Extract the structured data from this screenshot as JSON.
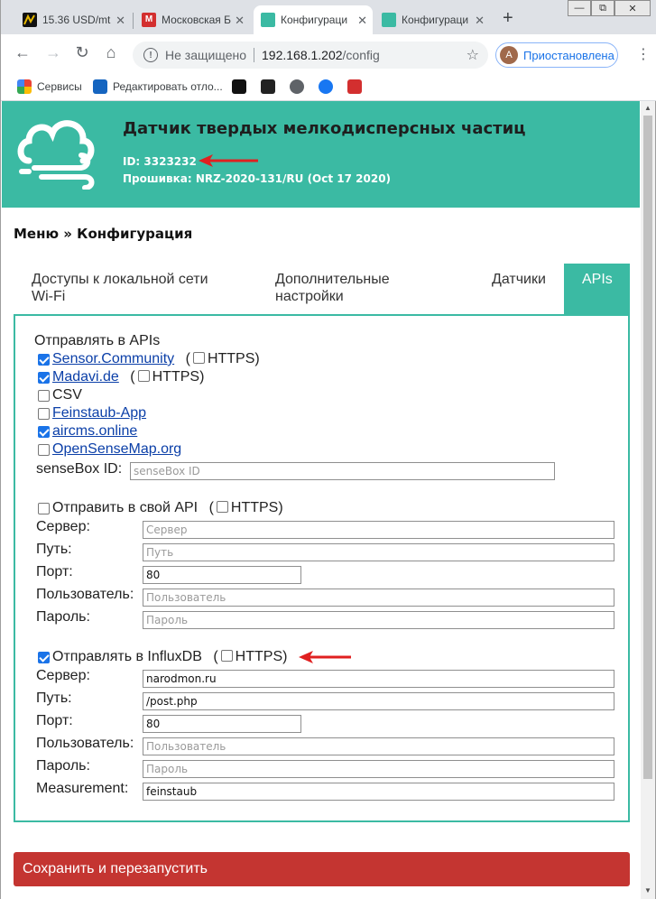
{
  "browser": {
    "tabs": [
      {
        "title": "15.36 USD/mt"
      },
      {
        "title": "Московская Б"
      },
      {
        "title": "Конфигураци"
      },
      {
        "title": "Конфигураци"
      }
    ],
    "new_tab": "+",
    "window_buttons": {
      "minimize": "—",
      "restore": "⧉",
      "close": "✕"
    },
    "security_label": "Не защищено",
    "url_host": "192.168.1.202",
    "url_path": "/config",
    "profile_initial": "A",
    "profile_status": "Приостановлена",
    "bookmarks": [
      {
        "label": "Сервисы"
      },
      {
        "label": "Редактировать отло..."
      }
    ],
    "colors": {
      "accent": "#3bbaa3",
      "save": "#c43531",
      "link": "#0b3fa8"
    }
  },
  "header": {
    "title": "Датчик твердых мелкодисперсных частиц",
    "id": "ID: 3323232",
    "firmware": "Прошивка: NRZ-2020-131/RU (Oct 17 2020)"
  },
  "breadcrumb": "Меню » Конфигурация",
  "tabs": [
    {
      "label": "Доступы к локальной сети Wi-Fi"
    },
    {
      "label": "Дополнительные настройки"
    },
    {
      "label": "Датчики"
    },
    {
      "label": "APIs",
      "active": true
    }
  ],
  "apis": {
    "heading": "Отправлять в APIs",
    "https": "HTTPS",
    "services": [
      {
        "label": "Sensor.Community",
        "checked": true,
        "link": true,
        "https": false
      },
      {
        "label": "Madavi.de",
        "checked": true,
        "link": true,
        "https": false
      },
      {
        "label": "CSV",
        "checked": false,
        "link": false
      },
      {
        "label": "Feinstaub-App",
        "checked": false,
        "link": true
      },
      {
        "label": "aircms.online",
        "checked": true,
        "link": true
      },
      {
        "label": "OpenSenseMap.org",
        "checked": false,
        "link": true
      }
    ],
    "sensebox_label": "senseBox ID:",
    "sensebox_placeholder": "senseBox ID"
  },
  "custom_api": {
    "label": "Отправить в свой API",
    "checked": false,
    "https": false,
    "fields": {
      "server": {
        "label": "Сервер:",
        "value": "",
        "placeholder": "Сервер"
      },
      "path": {
        "label": "Путь:",
        "value": "",
        "placeholder": "Путь"
      },
      "port": {
        "label": "Порт:",
        "value": "80"
      },
      "user": {
        "label": "Пользователь:",
        "value": "",
        "placeholder": "Пользователь"
      },
      "password": {
        "label": "Пароль:",
        "value": "",
        "placeholder": "Пароль"
      }
    }
  },
  "influx": {
    "label": "Отправлять в InfluxDB",
    "checked": true,
    "https": false,
    "fields": {
      "server": {
        "label": "Сервер:",
        "value": "narodmon.ru"
      },
      "path": {
        "label": "Путь:",
        "value": "/post.php"
      },
      "port": {
        "label": "Порт:",
        "value": "80"
      },
      "user": {
        "label": "Пользователь:",
        "value": "",
        "placeholder": "Пользователь"
      },
      "password": {
        "label": "Пароль:",
        "value": "",
        "placeholder": "Пароль"
      },
      "measurement": {
        "label": "Measurement:",
        "value": "feinstaub"
      }
    }
  },
  "save_button": "Сохранить и перезапустить"
}
